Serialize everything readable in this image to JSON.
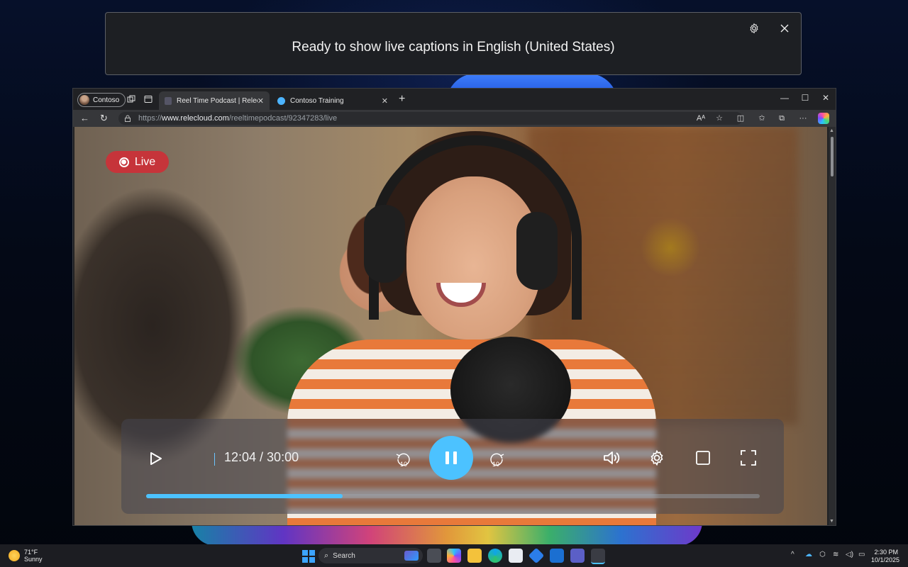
{
  "captions": {
    "text": "Ready to show live captions in English (United States)"
  },
  "browser": {
    "profile_name": "Contoso",
    "tabs": [
      {
        "title": "Reel Time Podcast | Releclo"
      },
      {
        "title": "Contoso Training"
      }
    ],
    "address": {
      "prefix": "https://",
      "host": "www.relecloud.com",
      "path": "/reeltimepodcast/92347283/live"
    }
  },
  "video": {
    "live_label": "Live",
    "time": "12:04 / 30:00",
    "skip_back_label": "10",
    "skip_forward_label": "10",
    "progress_fraction": 0.32
  },
  "taskbar": {
    "weather_temp": "71°F",
    "weather_desc": "Sunny",
    "search_label": "Search",
    "time": "2:30 PM",
    "date": "10/1/2025"
  },
  "colors": {
    "accent": "#4cc2ff",
    "live_badge": "#c6343a"
  }
}
